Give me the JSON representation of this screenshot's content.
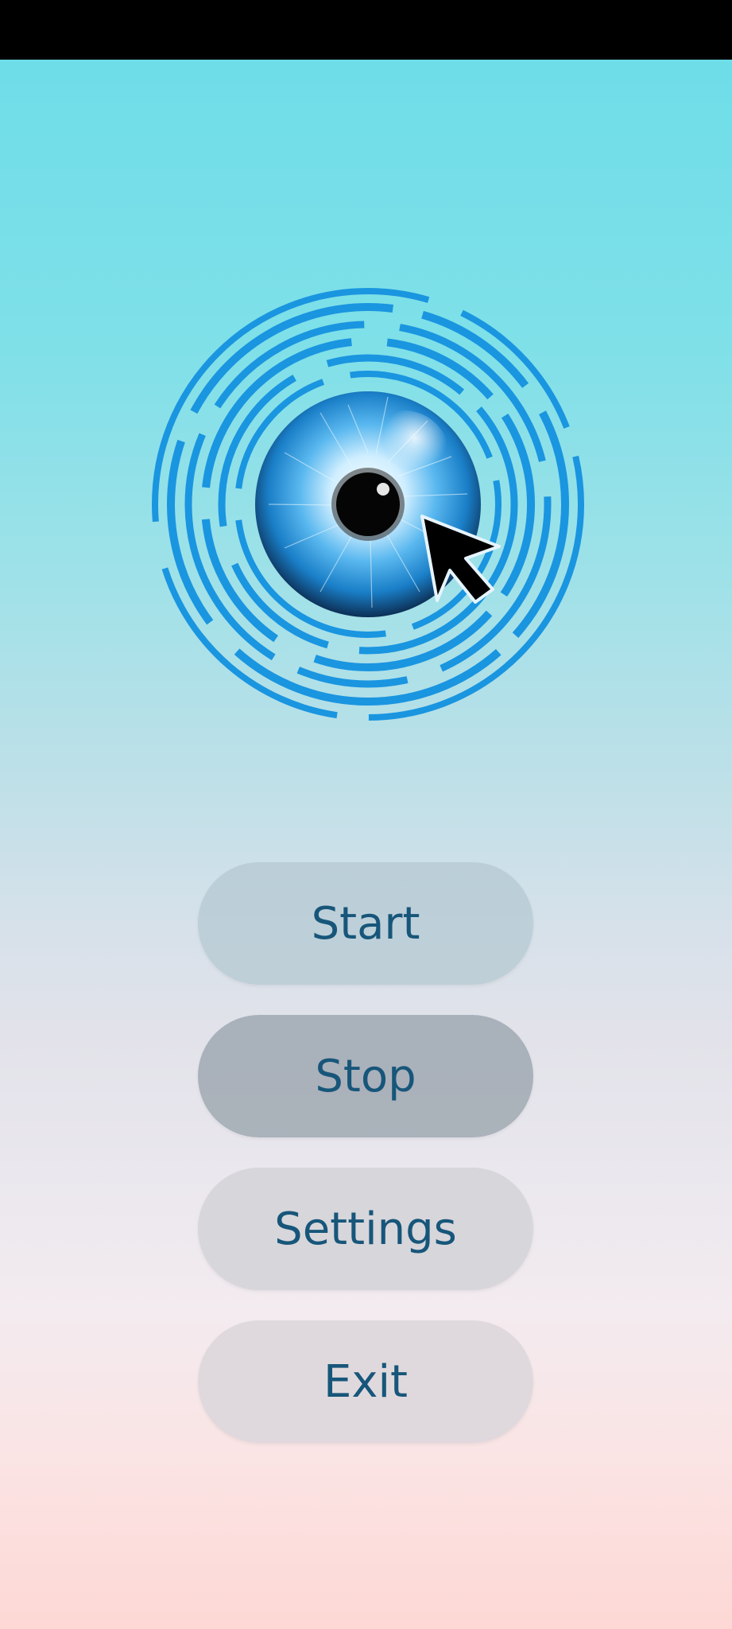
{
  "app": {
    "logo_icon": "eye-cursor-icon",
    "colors": {
      "accent": "#1a95e0",
      "button_text": "#17567a",
      "background_top": "#6edde8",
      "background_bottom": "#fdd8d5"
    }
  },
  "menu": {
    "start_label": "Start",
    "stop_label": "Stop",
    "settings_label": "Settings",
    "exit_label": "Exit"
  }
}
